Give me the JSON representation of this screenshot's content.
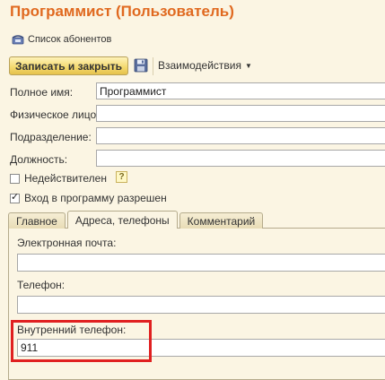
{
  "window": {
    "title": "Программист (Пользователь)"
  },
  "toolbar": {
    "abonents_label": "Список абонентов",
    "save_close_label": "Записать и закрыть",
    "interactions_label": "Взаимодействия",
    "icons": {
      "abonents": "phone-icon",
      "save": "floppy-disk-icon",
      "interactions_menu": "caret-down-icon"
    }
  },
  "form": {
    "full_name": {
      "label": "Полное имя:",
      "value": "Программист"
    },
    "individual": {
      "label": "Физическое лицо:",
      "value": ""
    },
    "department": {
      "label": "Подразделение:",
      "value": ""
    },
    "position": {
      "label": "Должность:",
      "value": ""
    },
    "inactive": {
      "label": "Недействителен",
      "checked": false
    },
    "login_allowed": {
      "label": "Вход в программу разрешен",
      "checked": true
    },
    "help_label": "?"
  },
  "tabs": [
    {
      "label": "Главное",
      "active": false
    },
    {
      "label": "Адреса, телефоны",
      "active": true
    },
    {
      "label": "Комментарий",
      "active": false
    }
  ],
  "contacts": {
    "email": {
      "label": "Электронная почта:",
      "value": ""
    },
    "phone": {
      "label": "Телефон:",
      "value": ""
    },
    "internal_phone": {
      "label": "Внутренний телефон:",
      "value": "911"
    }
  },
  "colors": {
    "title": "#e0691f",
    "background": "#fbf5e3",
    "highlight": "#e02020",
    "save_button": "#f3d86c"
  }
}
